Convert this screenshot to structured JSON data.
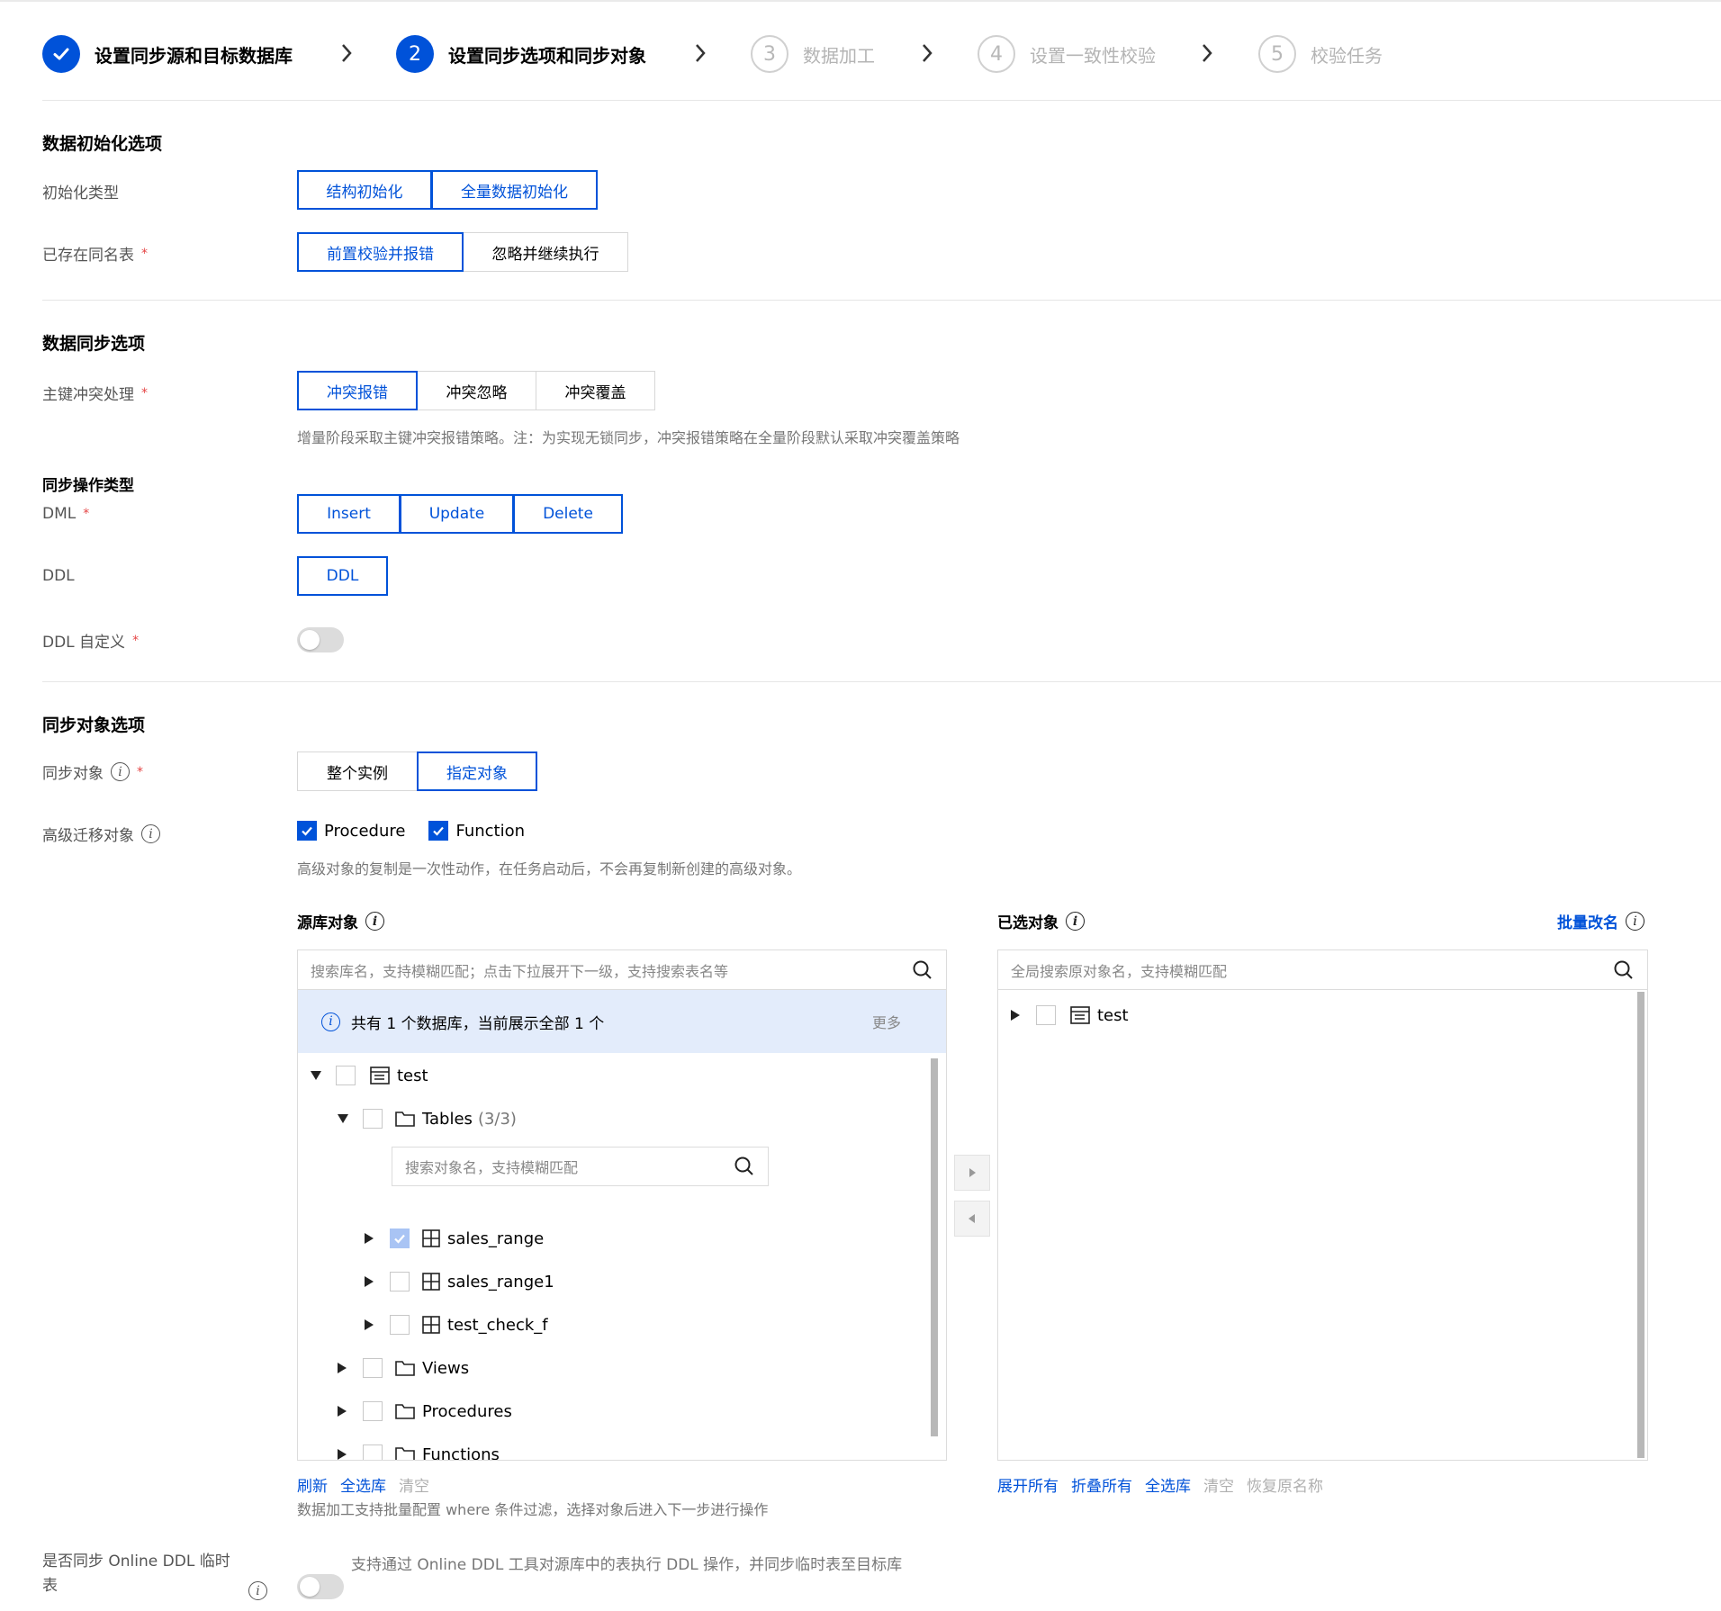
{
  "steps": [
    {
      "number": "",
      "label": "设置同步源和目标数据库",
      "state": "done"
    },
    {
      "number": "2",
      "label": "设置同步选项和同步对象",
      "state": "active"
    },
    {
      "number": "3",
      "label": "数据加工",
      "state": "todo"
    },
    {
      "number": "4",
      "label": "设置一致性校验",
      "state": "todo"
    },
    {
      "number": "5",
      "label": "校验任务",
      "state": "todo"
    }
  ],
  "init_section": {
    "title": "数据初始化选项",
    "init_type_label": "初始化类型",
    "init_type_options": [
      "结构初始化",
      "全量数据初始化"
    ],
    "existing_table_label": "已存在同名表",
    "existing_table_options": [
      "前置校验并报错",
      "忽略并继续执行"
    ],
    "required_mark": "*"
  },
  "sync_section": {
    "title": "数据同步选项",
    "conflict_label": "主键冲突处理",
    "conflict_options": [
      "冲突报错",
      "冲突忽略",
      "冲突覆盖"
    ],
    "conflict_hint": "增量阶段采取主键冲突报错策略。注：为实现无锁同步，冲突报错策略在全量阶段默认采取冲突覆盖策略",
    "op_type_title": "同步操作类型",
    "dml_label": "DML",
    "dml_options": [
      "Insert",
      "Update",
      "Delete"
    ],
    "ddl_label": "DDL",
    "ddl_options": [
      "DDL"
    ],
    "ddl_custom_label": "DDL 自定义",
    "ddl_custom_enabled": false
  },
  "object_section": {
    "title": "同步对象选项",
    "sync_object_label": "同步对象",
    "sync_object_options": [
      "整个实例",
      "指定对象"
    ],
    "advanced_label": "高级迁移对象",
    "advanced_options": [
      {
        "label": "Procedure",
        "checked": true
      },
      {
        "label": "Function",
        "checked": true
      }
    ],
    "advanced_hint": "高级对象的复制是一次性动作，在任务启动后，不会再复制新创建的高级对象。"
  },
  "source_panel": {
    "title": "源库对象",
    "search_placeholder": "搜索库名，支持模糊匹配；点击下拉展开下一级，支持搜索表名等",
    "notice": "共有 1 个数据库，当前展示全部 1 个",
    "more": "更多",
    "db_name": "test",
    "tables_label": "Tables",
    "tables_count": "(3/3)",
    "table_search_placeholder": "搜索对象名，支持模糊匹配",
    "tables": [
      {
        "name": "sales_range",
        "state": "half"
      },
      {
        "name": "sales_range1",
        "state": "off"
      },
      {
        "name": "test_check_f",
        "state": "off"
      }
    ],
    "views_label": "Views",
    "procedures_label": "Procedures",
    "functions_label": "Functions",
    "actions": {
      "refresh": "刷新",
      "select_all": "全选库",
      "clear": "清空"
    },
    "footer_hint": "数据加工支持批量配置 where 条件过滤，选择对象后进入下一步进行操作"
  },
  "selected_panel": {
    "title": "已选对象",
    "batch_rename": "批量改名",
    "search_placeholder": "全局搜索原对象名，支持模糊匹配",
    "db_name": "test",
    "actions": {
      "expand_all": "展开所有",
      "collapse_all": "折叠所有",
      "select_all": "全选库",
      "clear": "清空",
      "restore": "恢复原名称"
    }
  },
  "online_ddl": {
    "label_line1": "是否同步 Online DDL 临时",
    "label_line2": "表",
    "enabled": false,
    "hint": "支持通过 Online DDL 工具对源库中的表执行 DDL 操作，并同步临时表至目标库"
  },
  "colors": {
    "accent": "#0052d9",
    "required": "#e54545",
    "notice_bg": "#e3ecfb"
  }
}
